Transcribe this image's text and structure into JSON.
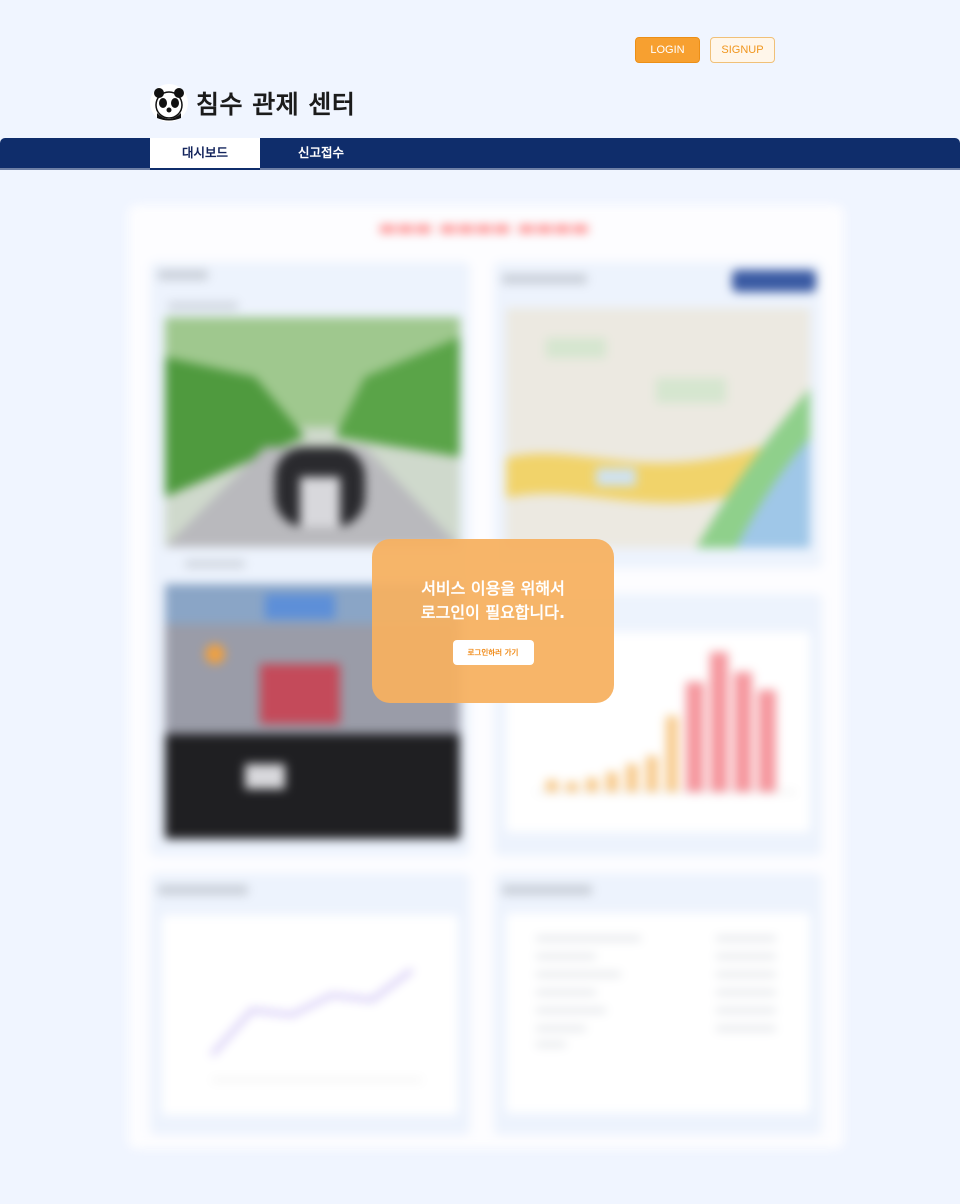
{
  "header": {
    "login_label": "LOGIN",
    "signup_label": "SIGNUP",
    "site_title": "침수 관제 센터",
    "logo_icon": "panda-icon"
  },
  "nav": {
    "tabs": [
      {
        "label": "대시보드",
        "active": true
      },
      {
        "label": "신고접수",
        "active": false
      }
    ]
  },
  "modal": {
    "message": "서비스 이용을 위해서\n로그인이 필요합니다.",
    "button_label": "로그인하러 가기"
  },
  "colors": {
    "nav_bg": "#0f2d6b",
    "login_btn": "#f7a030",
    "modal_bg": "#f6b060",
    "page_bg": "#f0f5ff"
  }
}
